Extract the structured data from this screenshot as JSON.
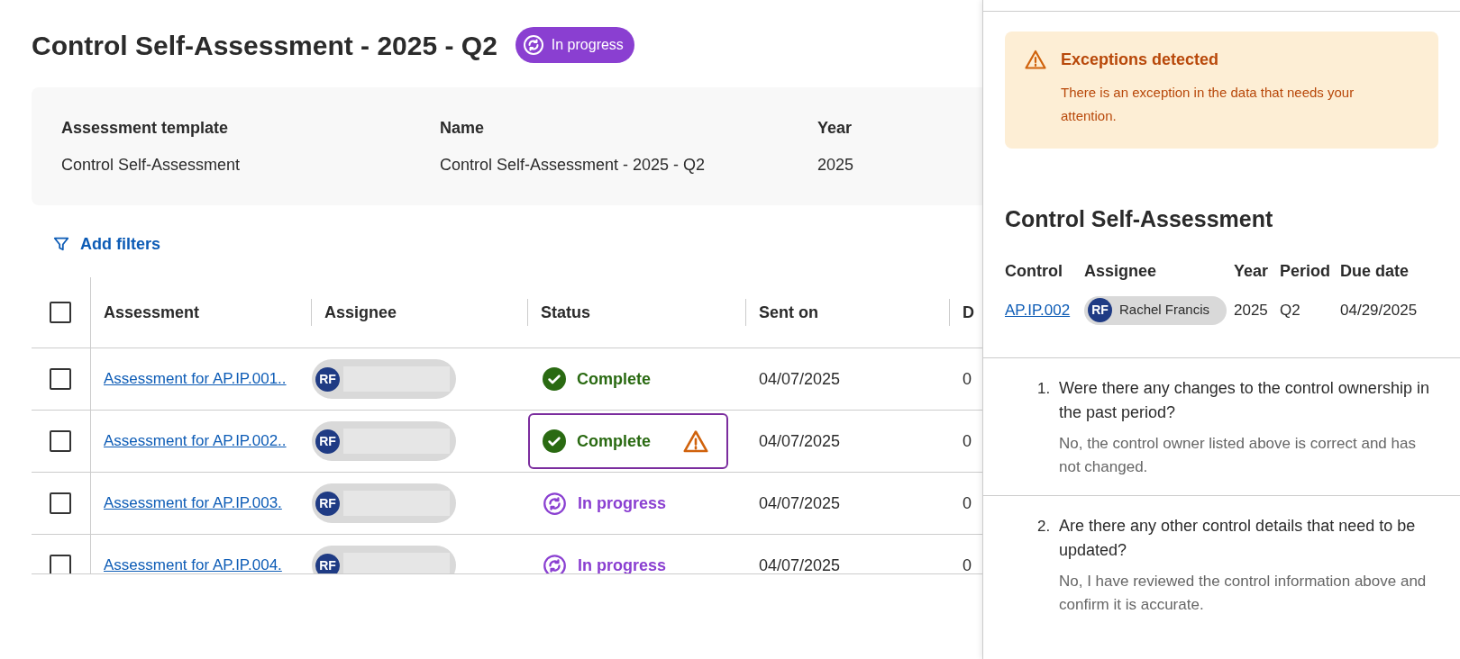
{
  "page": {
    "title": "Control Self-Assessment - 2025 - Q2",
    "status": {
      "kind": "in_progress",
      "label": "In progress"
    }
  },
  "summary": [
    {
      "label": "Assessment template",
      "value": "Control Self-Assessment"
    },
    {
      "label": "Name",
      "value": "Control Self-Assessment - 2025 - Q2"
    },
    {
      "label": "Year",
      "value": "2025"
    }
  ],
  "filter_button": "Add filters",
  "table": {
    "select_all": {
      "checked": false
    },
    "columns": [
      "Assessment",
      "Assignee",
      "Status",
      "Sent on",
      "D"
    ],
    "rows": [
      {
        "checked": false,
        "assessment": "Assessment for AP.IP.001..",
        "initials": "RF",
        "status": {
          "kind": "complete",
          "label": "Complete"
        },
        "exception": false,
        "selected": false,
        "sent_on": "04/07/2025",
        "column_5": "0"
      },
      {
        "checked": false,
        "assessment": "Assessment for AP.IP.002..",
        "initials": "RF",
        "status": {
          "kind": "complete",
          "label": "Complete"
        },
        "exception": true,
        "selected": true,
        "sent_on": "04/07/2025",
        "column_5": "0"
      },
      {
        "checked": false,
        "assessment": "Assessment for AP.IP.003.",
        "initials": "RF",
        "status": {
          "kind": "in_progress",
          "label": "In progress"
        },
        "exception": false,
        "selected": false,
        "sent_on": "04/07/2025",
        "column_5": "0"
      },
      {
        "checked": false,
        "assessment": "Assessment for AP.IP.004.",
        "initials": "RF",
        "status": {
          "kind": "in_progress",
          "label": "In progress"
        },
        "exception": false,
        "selected": false,
        "sent_on": "04/07/2025",
        "column_5": "0"
      }
    ]
  },
  "panel": {
    "alert": {
      "title": "Exceptions detected",
      "message": "There is an exception in the data that needs your attention."
    },
    "heading": "Control Self-Assessment",
    "columns": [
      "Control",
      "Assignee",
      "Year",
      "Period",
      "Due date"
    ],
    "row": {
      "control": "AP.IP.002",
      "initials": "RF",
      "assignee": "Rachel Francis",
      "year": "2025",
      "period": "Q2",
      "due_date": "04/29/2025"
    },
    "questions": [
      {
        "number": "1.",
        "question": "Were there any changes to the control ownership in the past period?",
        "answer": "No, the control owner listed above is correct and has not changed."
      },
      {
        "number": "2.",
        "question": "Are there any other control details that need to be updated?",
        "answer": "No, I have reviewed the control information above and confirm it is accurate."
      }
    ]
  }
}
